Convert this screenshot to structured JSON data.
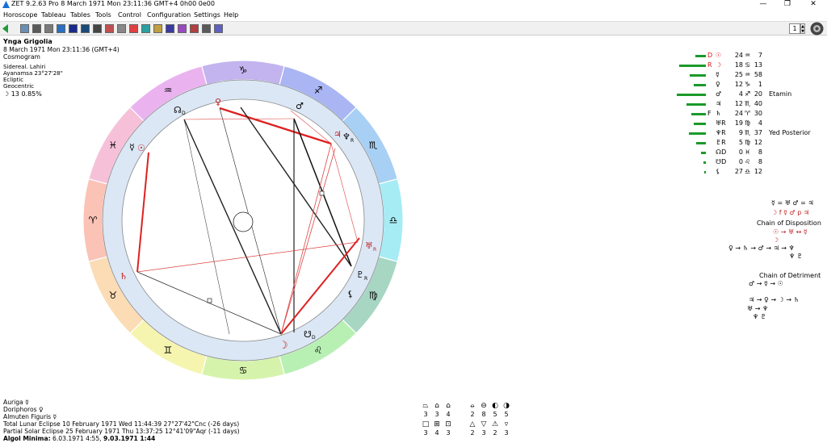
{
  "window": {
    "title": "ZET 9.2.63 Pro    8 March 1971  Mon  23:11:36 GMT+4 0h00  0e00",
    "minimize": "—",
    "maximize": "❐",
    "close": "✕"
  },
  "menu": [
    "Horoscope",
    "Tableau",
    "Tables",
    "Tools",
    "Control",
    "Configuration",
    "Settings",
    "Help"
  ],
  "toolbar": {
    "page_number": "1",
    "back_icon": "left-arrow-icon"
  },
  "header_info": {
    "name": "Ynga Grigolia",
    "datetime": "8 March 1971  Mon  23:11:36 (GMT+4)",
    "chart_type": "Cosmogram",
    "zodiac": "Sidereal. Lahiri",
    "ayanamsa": "Ayanamsa 23°27'28\"",
    "plane": "Ecliptic",
    "center": "Geocentric",
    "moon_phase": "☽  13  0.85%"
  },
  "zodiac_signs": [
    "♑",
    "♐",
    "♏",
    "♎",
    "♍",
    "♌",
    "♋",
    "♊",
    "♉",
    "♈",
    "♓",
    "♒"
  ],
  "zodiac_colors": [
    "#c3b4ef",
    "#a9b6f3",
    "#a8d0f5",
    "#a6ecf5",
    "#a7d6c2",
    "#b8f0b4",
    "#d6f3ac",
    "#f6f5b0",
    "#fbdcb5",
    "#fbc2b6",
    "#f7c0d9",
    "#eab3f0"
  ],
  "chart_glyphs": {
    "venus": "♀",
    "mars": "♂",
    "north_node": "☊",
    "north_node_sub": "D",
    "mercury": "☿",
    "sun": "☉",
    "jupiter": "♃",
    "neptune": "♆",
    "neptune_sub": "R",
    "uranus": "♅",
    "uranus_sub": "R",
    "pluto": "♇",
    "pluto_sub": "R",
    "lilith": "⚸",
    "saturn": "♄",
    "moon": "☽",
    "south_node": "☋",
    "south_node_sub": "D"
  },
  "planets": [
    {
      "dignity": "D",
      "glyph": "☉",
      "deg": "24",
      "sign": "♒",
      "min": "7",
      "color": "#d21414",
      "note": ""
    },
    {
      "dignity": "R",
      "glyph": "☽",
      "deg": "18",
      "sign": "♋",
      "min": "13",
      "color": "#d21414",
      "note": ""
    },
    {
      "dignity": "",
      "glyph": "☿",
      "deg": "25",
      "sign": "♒",
      "min": "58",
      "color": "#000",
      "note": ""
    },
    {
      "dignity": "",
      "glyph": "♀",
      "deg": "12",
      "sign": "♑",
      "min": "1",
      "color": "#000",
      "note": ""
    },
    {
      "dignity": "",
      "glyph": "♂",
      "deg": "4",
      "sign": "♐",
      "min": "20",
      "color": "#000",
      "note": "Etamin"
    },
    {
      "dignity": "",
      "glyph": "♃",
      "deg": "12",
      "sign": "♏",
      "min": "40",
      "color": "#000",
      "note": ""
    },
    {
      "dignity": "F",
      "glyph": "♄",
      "deg": "24",
      "sign": "♈",
      "min": "30",
      "color": "#000",
      "note": ""
    },
    {
      "dignity": "",
      "glyph": "♅R",
      "deg": "19",
      "sign": "♍",
      "min": "4",
      "color": "#000",
      "note": ""
    },
    {
      "dignity": "",
      "glyph": "♆R",
      "deg": "9",
      "sign": "♏",
      "min": "37",
      "color": "#000",
      "note": "Yed Posterior"
    },
    {
      "dignity": "",
      "glyph": "♇R",
      "deg": "5",
      "sign": "♍",
      "min": "12",
      "color": "#000",
      "note": ""
    },
    {
      "dignity": "",
      "glyph": "☊D",
      "deg": "0",
      "sign": "♓",
      "min": "8",
      "color": "#000",
      "note": ""
    },
    {
      "dignity": "",
      "glyph": "☋D",
      "deg": "0",
      "sign": "♌",
      "min": "8",
      "color": "#000",
      "note": ""
    },
    {
      "dignity": "",
      "glyph": "⚸",
      "deg": "27",
      "sign": "♎",
      "min": "12",
      "color": "#000",
      "note": ""
    }
  ],
  "planet_strength": [
    0.22,
    0.55,
    0.33,
    0.25,
    0.6,
    0.4,
    0.3,
    0.25,
    0.35,
    0.2,
    0.1,
    0.05,
    0.03
  ],
  "chains": {
    "top_line1": "☿ = ♅  ♂ = ♃",
    "top_line2": "☽ f ☿ ♂ p ♃",
    "disposition_title": "Chain of Disposition",
    "disp1": "☉ → ♅ ↔ ☿",
    "disp2": "☽",
    "disp3": "♀ → ♄ → ♂ → ♃ → ♆",
    "disp4": "♆ ♇",
    "detriment_title": "Chain of Detriment",
    "det1": "♂ → ☿ → ☉",
    "det2": "♃ → ♀ → ☽ → ♄",
    "det3": "♅ → ♆",
    "det4": "♆ ♇"
  },
  "bottom": {
    "auriga": "Auriga  ☿",
    "doriphoros": "Doriphoros  ♀",
    "almuten": "Almuten Figuris  ☿",
    "lunar_eclipse": "Total Lunar Eclipse 10 February 1971 Wed 11:44:39 27°27'42\"Cnc (-26 days)",
    "solar_eclipse": "Partial Solar Eclipse 25 February 1971 Thu 13:37:25 12°41'09\"Aqr (-11 days)",
    "algol_label": "Algol Minima:",
    "algol_value": "6.03.1971  4:55,",
    "algol_value2": "9.03.1971  1:44"
  },
  "aspect_grid": {
    "row1": [
      "⏢",
      "⌂",
      "⌂",
      "⦵",
      "⊖",
      "◐",
      "◑"
    ],
    "row1_nums": [
      "3",
      "3",
      "4",
      "2",
      "8",
      "5",
      "5"
    ],
    "row2": [
      "□",
      "⊞",
      "⊡",
      "△",
      "▽",
      "⚠",
      "▿"
    ],
    "row2_nums": [
      "3",
      "4",
      "3",
      "2",
      "3",
      "2",
      "3"
    ]
  }
}
